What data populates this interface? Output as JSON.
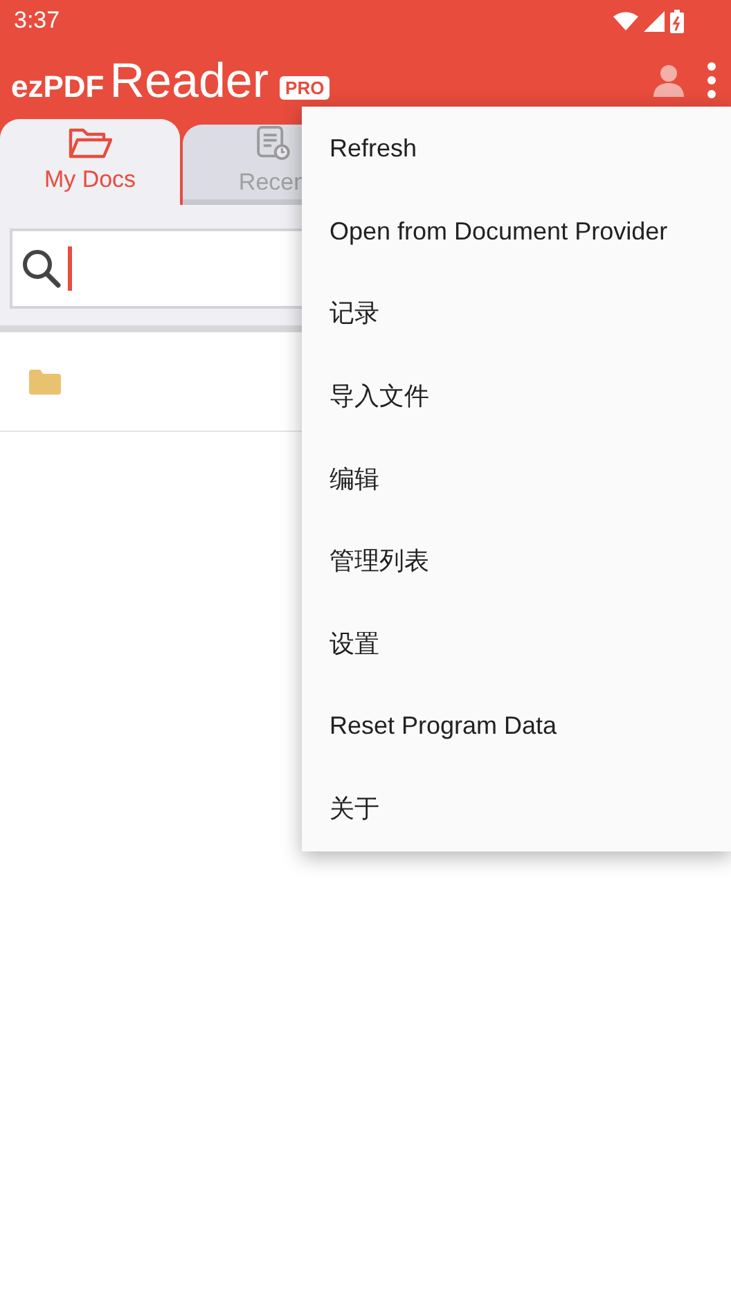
{
  "status_bar": {
    "time": "3:37"
  },
  "app_bar": {
    "logo_prefix": "ezPDF",
    "logo_word": "Reader",
    "badge": "PRO"
  },
  "tabs": [
    {
      "label": "My Docs",
      "selected": true,
      "kind": "folder"
    },
    {
      "label": "Recen",
      "selected": false,
      "kind": "recent"
    }
  ],
  "file_list": [
    {
      "kind": "folder"
    }
  ],
  "menu": {
    "items": [
      "Refresh",
      "Open from Document Provider",
      "记录",
      "导入文件",
      "编辑",
      "管理列表",
      "设置",
      "Reset Program Data",
      "关于"
    ]
  }
}
